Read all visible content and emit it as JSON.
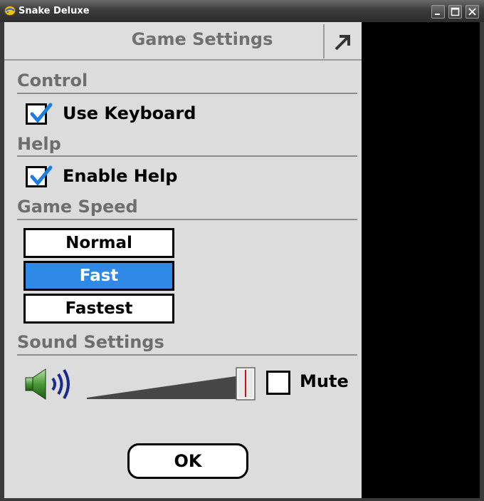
{
  "window": {
    "title": "Snake Deluxe"
  },
  "header": {
    "title": "Game Settings"
  },
  "sections": {
    "control": "Control",
    "help": "Help",
    "speed": "Game Speed",
    "sound": "Sound Settings"
  },
  "control": {
    "use_keyboard": {
      "label": "Use Keyboard",
      "checked": true
    }
  },
  "help": {
    "enable_help": {
      "label": "Enable Help",
      "checked": true
    }
  },
  "speed": {
    "options": [
      "Normal",
      "Fast",
      "Fastest"
    ],
    "selected": "Fast"
  },
  "sound": {
    "volume_fraction": 1.0,
    "mute": {
      "label": "Mute",
      "checked": false
    }
  },
  "ok_label": "OK",
  "colors": {
    "accent": "#2e8ae6",
    "checkmark": "#1e7fe0",
    "panel": "#dcdcdc",
    "section_text": "#6e6e6e",
    "speaker_green": "#3c8a2c",
    "sound_waves": "#1a2a8a"
  },
  "icons": {
    "app": "snake-app-icon",
    "minimize": "minimize-icon",
    "maximize": "maximize-icon",
    "close": "close-icon",
    "expand": "expand-arrow-icon",
    "speaker": "speaker-icon"
  }
}
